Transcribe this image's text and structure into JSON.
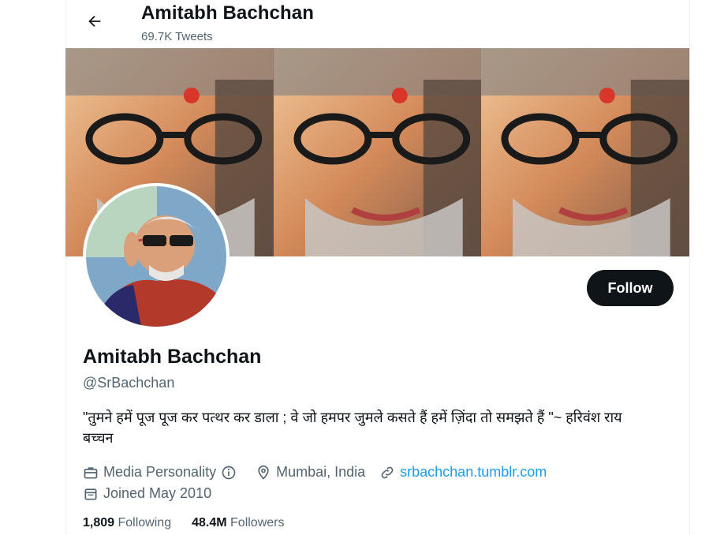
{
  "header": {
    "back_icon": "arrow-left-icon",
    "title": "Amitabh Bachchan",
    "subtitle": "69.7K Tweets"
  },
  "banner": {
    "panels": 3
  },
  "profile": {
    "name": "Amitabh Bachchan",
    "handle": "@SrBachchan",
    "bio": "\"तुमने हमें पूज पूज कर पत्थर कर डाला ; वे जो हमपर जुमले कसते हैं हमें ज़िंदा तो समझते हैं \"~ हरिवंश राय बच्चन",
    "category": "Media Personality",
    "location": "Mumbai, India",
    "website": "srbachchan.tumblr.com",
    "joined": "Joined May 2010"
  },
  "actions": {
    "follow_label": "Follow"
  },
  "stats": {
    "following_count": "1,809",
    "following_label": "Following",
    "followers_count": "48.4M",
    "followers_label": "Followers"
  },
  "colors": {
    "accent": "#1d9bf0",
    "text": "#0f1419",
    "muted": "#536471",
    "button": "#0f1419"
  }
}
